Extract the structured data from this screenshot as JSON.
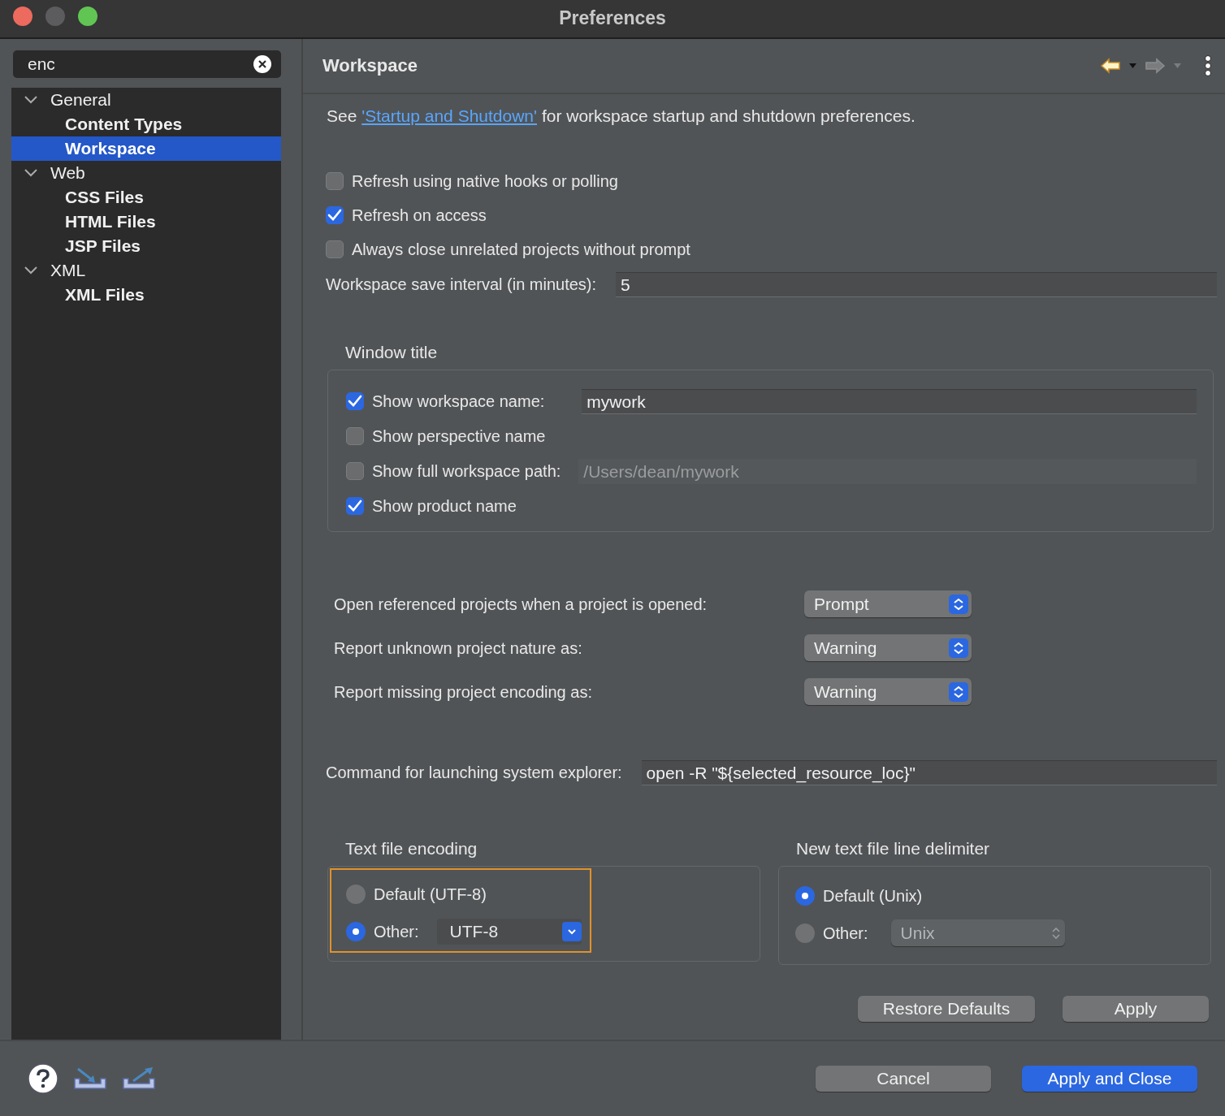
{
  "window": {
    "title": "Preferences"
  },
  "sidebar": {
    "search": {
      "value": "enc"
    },
    "tree": [
      {
        "label": "General",
        "expanded": true,
        "selected": false,
        "children": [
          {
            "label": "Content Types",
            "selected": false
          },
          {
            "label": "Workspace",
            "selected": true
          }
        ]
      },
      {
        "label": "Web",
        "expanded": true,
        "selected": false,
        "children": [
          {
            "label": "CSS Files",
            "selected": false
          },
          {
            "label": "HTML Files",
            "selected": false
          },
          {
            "label": "JSP Files",
            "selected": false
          }
        ]
      },
      {
        "label": "XML",
        "expanded": true,
        "selected": false,
        "children": [
          {
            "label": "XML Files",
            "selected": false
          }
        ]
      }
    ]
  },
  "page": {
    "title": "Workspace",
    "intro": {
      "before": "See ",
      "link": "'Startup and Shutdown'",
      "after": " for workspace startup and shutdown preferences."
    },
    "checkboxes": [
      {
        "label": "Refresh using native hooks or polling",
        "checked": false
      },
      {
        "label": "Refresh on access",
        "checked": true
      },
      {
        "label": "Always close unrelated projects without prompt",
        "checked": false
      }
    ],
    "save_interval": {
      "label": "Workspace save interval (in minutes):",
      "value": "5"
    },
    "window_title": {
      "title": "Window title",
      "rows": [
        {
          "kind": "checkbox-field",
          "label": "Show workspace name:",
          "checked": true,
          "value": "mywork",
          "disabled": false
        },
        {
          "kind": "checkbox",
          "label": "Show perspective name",
          "checked": false
        },
        {
          "kind": "checkbox-field",
          "label": "Show full workspace path:",
          "checked": false,
          "value": "/Users/dean/mywork",
          "disabled": true
        },
        {
          "kind": "checkbox",
          "label": "Show product name",
          "checked": true
        }
      ]
    },
    "selects": [
      {
        "label": "Open referenced projects when a project is opened:",
        "value": "Prompt"
      },
      {
        "label": "Report unknown project nature as:",
        "value": "Warning"
      },
      {
        "label": "Report missing project encoding as:",
        "value": "Warning"
      }
    ],
    "command": {
      "label": "Command for launching system explorer:",
      "value": "open -R \"${selected_resource_loc}\""
    },
    "groups": [
      {
        "title": "Text file encoding",
        "highlighted": true,
        "options": [
          {
            "kind": "radio",
            "label": "Default (UTF-8)",
            "selected": false
          },
          {
            "kind": "radio-combo",
            "label": "Other:",
            "selected": true,
            "value": "UTF-8",
            "disabled": false
          }
        ]
      },
      {
        "title": "New text file line delimiter",
        "highlighted": false,
        "options": [
          {
            "kind": "radio",
            "label": "Default (Unix)",
            "selected": true
          },
          {
            "kind": "radio-select",
            "label": "Other:",
            "selected": false,
            "value": "Unix",
            "disabled": true
          }
        ]
      }
    ],
    "buttons": [
      {
        "label": "Restore Defaults"
      },
      {
        "label": "Apply"
      }
    ]
  },
  "footer": {
    "buttons": [
      {
        "label": "Cancel",
        "primary": false
      },
      {
        "label": "Apply and Close",
        "primary": true
      }
    ]
  }
}
